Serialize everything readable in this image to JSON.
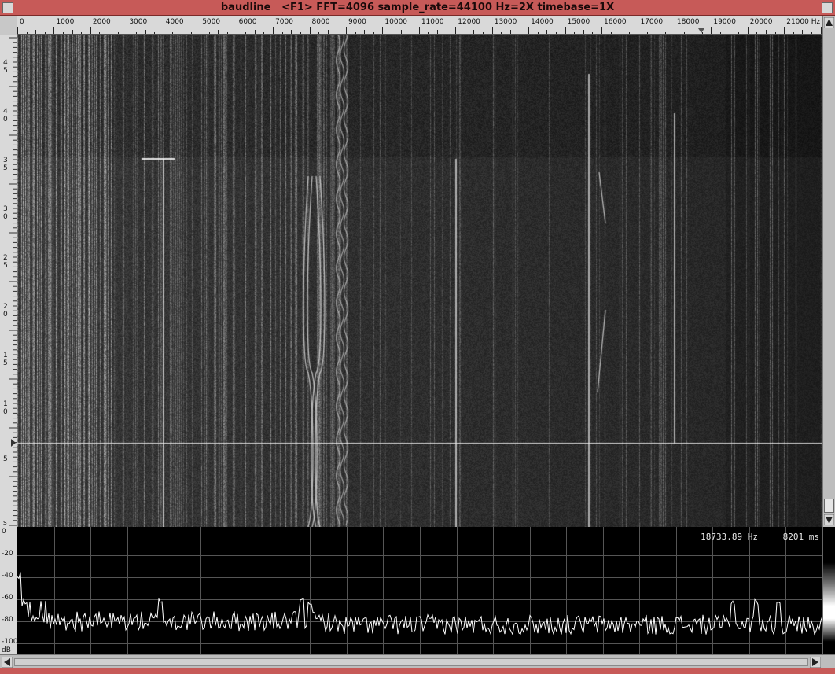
{
  "window": {
    "title": "baudline   <F1> FFT=4096 sample_rate=44100 Hz=2X timebase=1X"
  },
  "freq_axis": {
    "tick_labels": [
      "0",
      "1000",
      "2000",
      "3000",
      "4000",
      "5000",
      "6000",
      "7000",
      "8000",
      "9000",
      "10000",
      "11000",
      "12000",
      "13000",
      "14000",
      "15000",
      "16000",
      "17000",
      "18000",
      "19000",
      "20000",
      "21000 Hz"
    ],
    "max_hz": 22050,
    "cursor_hz": 18733.89
  },
  "time_axis": {
    "tick_labels": [
      "45",
      "40",
      "35",
      "30",
      "25",
      "20",
      "15",
      "10",
      "5",
      "s"
    ]
  },
  "spectrum": {
    "db_labels": [
      "0",
      "-20",
      "-40",
      "-60",
      "-80",
      "-100",
      "dB"
    ],
    "db_range": [
      0,
      -110
    ],
    "freq_readout": "18733.89 Hz",
    "time_readout": "8201 ms"
  },
  "colors": {
    "titlebar": "#c75a58",
    "spectrogram_bg": "#111111",
    "trace": "#ffffff",
    "grid": "#555555"
  },
  "icons": {
    "close": "square-button-icon",
    "maximize": "square-button-icon",
    "scroll_up": "arrow-up-icon",
    "scroll_down": "arrow-down-icon",
    "scroll_left": "arrow-left-icon",
    "scroll_right": "arrow-right-icon",
    "cursor_marker": "triangle-marker-icon"
  }
}
